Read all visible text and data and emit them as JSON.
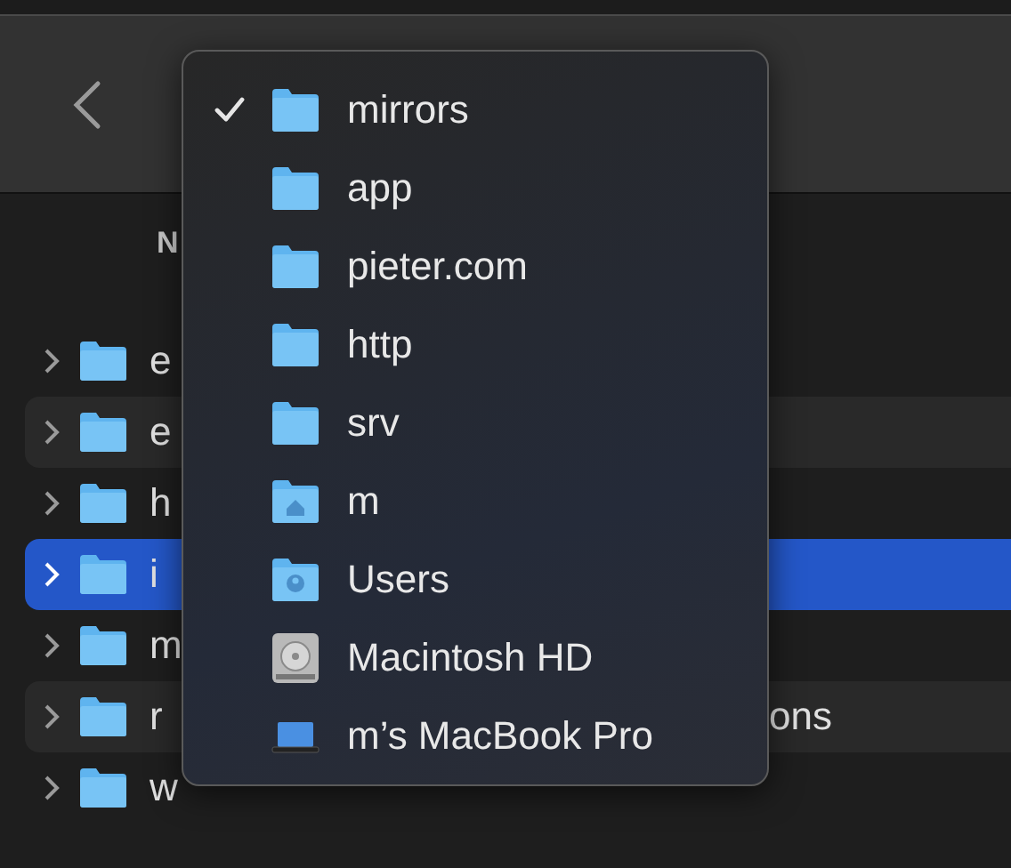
{
  "toolbar": {
    "column_header": "N"
  },
  "rows": [
    {
      "label": "e",
      "selected": false
    },
    {
      "label": "e",
      "selected": false
    },
    {
      "label": "h",
      "selected": false
    },
    {
      "label": "i",
      "selected": true
    },
    {
      "label": "m",
      "selected": false
    },
    {
      "label": "r",
      "tail": "ons",
      "selected": false
    },
    {
      "label": "w",
      "selected": false
    }
  ],
  "menu": {
    "items": [
      {
        "kind": "folder",
        "label": "mirrors",
        "checked": true
      },
      {
        "kind": "folder",
        "label": "app",
        "checked": false
      },
      {
        "kind": "folder",
        "label": "pieter.com",
        "checked": false
      },
      {
        "kind": "folder",
        "label": "http",
        "checked": false
      },
      {
        "kind": "folder",
        "label": "srv",
        "checked": false
      },
      {
        "kind": "home",
        "label": "m",
        "checked": false
      },
      {
        "kind": "user",
        "label": "Users",
        "checked": false
      },
      {
        "kind": "disk",
        "label": "Macintosh HD",
        "checked": false
      },
      {
        "kind": "laptop",
        "label": "m’s MacBook Pro",
        "checked": false
      }
    ]
  }
}
